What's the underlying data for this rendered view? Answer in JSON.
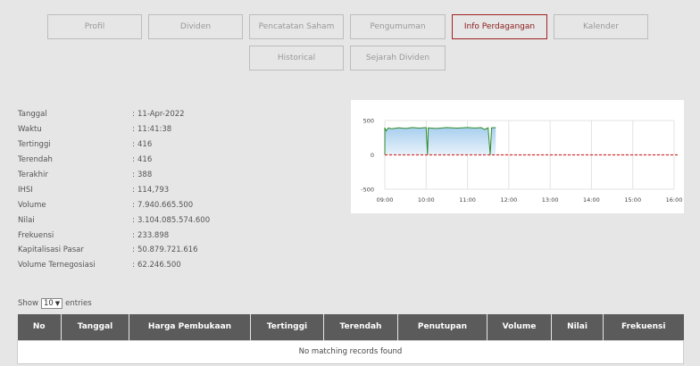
{
  "tabs": {
    "profil": "Profil",
    "dividen": "Dividen",
    "pencatatan": "Pencatatan Saham",
    "pengumuman": "Pengumuman",
    "info": "Info Perdagangan",
    "kalender": "Kalender",
    "historical": "Historical",
    "sejarah": "Sejarah Dividen"
  },
  "info": [
    {
      "label": "Tanggal",
      "value": "11-Apr-2022"
    },
    {
      "label": "Waktu",
      "value": "11:41:38"
    },
    {
      "label": "Tertinggi",
      "value": "416"
    },
    {
      "label": "Terendah",
      "value": "416"
    },
    {
      "label": "Terakhir",
      "value": "388"
    },
    {
      "label": "IHSI",
      "value": "114,793"
    },
    {
      "label": "Volume",
      "value": "7.940.665.500"
    },
    {
      "label": "Nilai",
      "value": "3.104.085.574.600"
    },
    {
      "label": "Frekuensi",
      "value": "233.898"
    },
    {
      "label": "Kapitalisasi Pasar",
      "value": "50.879.721.616"
    },
    {
      "label": "Volume Ternegosiasi",
      "value": "62.246.500"
    }
  ],
  "info_separator": ":",
  "chart_data": {
    "type": "area",
    "title": "",
    "xlabel": "",
    "ylabel": "",
    "x_ticks": [
      "09:00",
      "10:00",
      "11:00",
      "12:00",
      "13:00",
      "14:00",
      "15:00",
      "16:00"
    ],
    "y_ticks": [
      "500",
      "0",
      "-500"
    ],
    "ylim": [
      -500,
      500
    ],
    "grid": true,
    "series": [
      {
        "color": "#2e8b2e",
        "fill": "#a9cfee",
        "points": [
          [
            "09:00",
            0
          ],
          [
            "09:00",
            395
          ],
          [
            "09:02",
            350
          ],
          [
            "09:05",
            392
          ],
          [
            "09:10",
            380
          ],
          [
            "09:20",
            395
          ],
          [
            "09:30",
            385
          ],
          [
            "09:40",
            398
          ],
          [
            "09:50",
            390
          ],
          [
            "10:00",
            397
          ],
          [
            "10:02",
            0
          ],
          [
            "10:03",
            393
          ],
          [
            "10:15",
            385
          ],
          [
            "10:30",
            397
          ],
          [
            "10:45",
            390
          ],
          [
            "11:00",
            398
          ],
          [
            "11:10",
            392
          ],
          [
            "11:20",
            396
          ],
          [
            "11:25",
            370
          ],
          [
            "11:30",
            394
          ],
          [
            "11:33",
            0
          ],
          [
            "11:35",
            395
          ],
          [
            "11:41",
            396
          ]
        ]
      }
    ],
    "reference_line": {
      "value": 0,
      "color": "#d63333",
      "style": "dashed"
    }
  },
  "table": {
    "show_label": "Show",
    "entries_value": "10",
    "entries_label": "entries",
    "columns": [
      "No",
      "Tanggal",
      "Harga Pembukaan",
      "Tertinggi",
      "Terendah",
      "Penutupan",
      "Volume",
      "Nilai",
      "Frekuensi"
    ],
    "empty_message": "No matching records found"
  }
}
